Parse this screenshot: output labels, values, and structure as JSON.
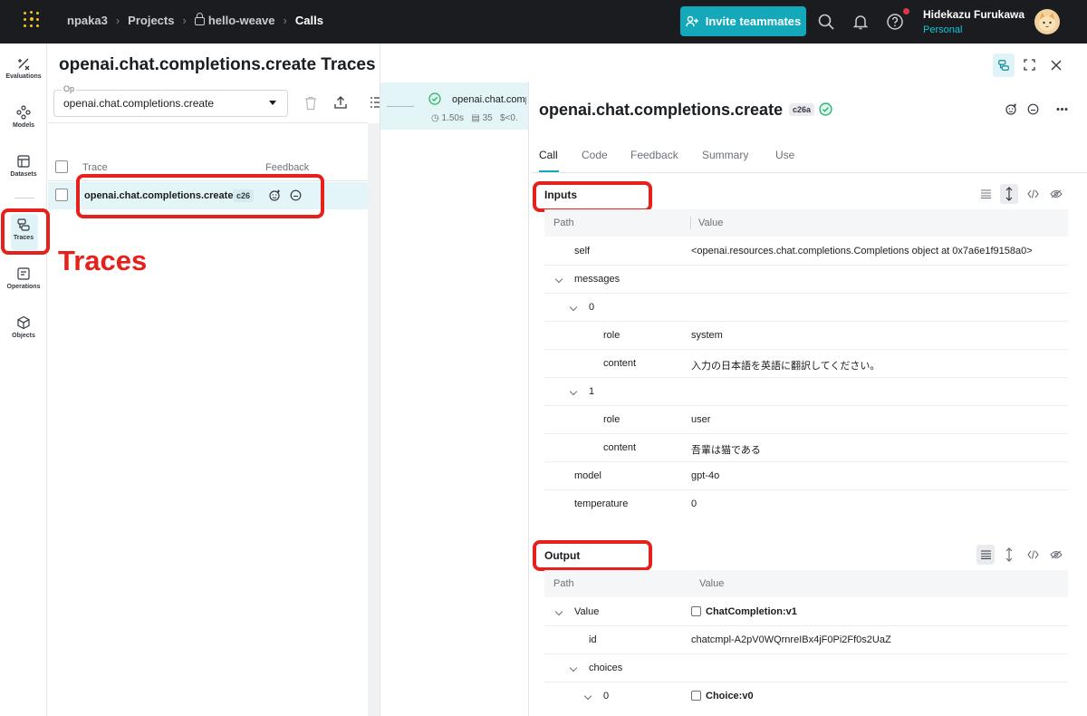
{
  "topbar": {
    "breadcrumbs": [
      "npaka3",
      "Projects",
      "hello-weave",
      "Calls"
    ],
    "invite_label": "Invite teammates",
    "user_name": "Hidekazu Furukawa",
    "workspace": "Personal"
  },
  "sidebar": {
    "items": [
      {
        "label": "Evaluations",
        "icon": "evaluations-icon"
      },
      {
        "label": "Models",
        "icon": "models-icon"
      },
      {
        "label": "Datasets",
        "icon": "datasets-icon"
      },
      {
        "label": "Traces",
        "icon": "traces-icon",
        "selected": true
      },
      {
        "label": "Operations",
        "icon": "operations-icon"
      },
      {
        "label": "Objects",
        "icon": "objects-icon"
      }
    ]
  },
  "annotation": {
    "label": "Traces",
    "color": "#e6201b"
  },
  "main": {
    "title": "openai.chat.completions.create Traces",
    "op_filter": {
      "label": "Op",
      "value": "openai.chat.completions.create"
    },
    "columns": {
      "trace": "Trace",
      "feedback": "Feedback"
    },
    "rows": [
      {
        "name": "openai.chat.completions.create",
        "id": "c26"
      }
    ]
  },
  "mid": {
    "name": "openai.chat.completions.create",
    "latency": "1.50s",
    "tokens": "35",
    "cost": "$<0."
  },
  "detail": {
    "title": "openai.chat.completions.create",
    "id": "c26a",
    "tabs": [
      "Call",
      "Code",
      "Feedback",
      "Summary",
      "Use"
    ],
    "active_tab": "Call",
    "inputs": {
      "title": "Inputs",
      "col_path": "Path",
      "col_value": "Value",
      "rows": [
        {
          "key": "self",
          "value": "<openai.resources.chat.completions.Completions object at 0x7a6e1f9158a0>"
        },
        {
          "key": "messages",
          "value": ""
        },
        {
          "key": "0",
          "value": ""
        },
        {
          "key": "role",
          "value": "system"
        },
        {
          "key": "content",
          "value": "入力の日本語を英語に翻訳してください。"
        },
        {
          "key": "1",
          "value": ""
        },
        {
          "key": "role",
          "value": "user"
        },
        {
          "key": "content",
          "value": "吾輩は猫である"
        },
        {
          "key": "model",
          "value": "gpt-4o"
        },
        {
          "key": "temperature",
          "value": "0"
        }
      ]
    },
    "output": {
      "title": "Output",
      "col_path": "Path",
      "col_value": "Value",
      "rows": [
        {
          "key": "Value",
          "value": "ChatCompletion:v1"
        },
        {
          "key": "id",
          "value": "chatcmpl-A2pV0WQrnreIBx4jF0Pi2Ff0s2UaZ"
        },
        {
          "key": "choices",
          "value": ""
        },
        {
          "key": "0",
          "value": "Choice:v0"
        }
      ]
    }
  },
  "colors": {
    "accent": "#13a9ba",
    "success": "#18b26b",
    "highlight_row": "#e4f5f7",
    "annotation_red": "#e6201b"
  }
}
